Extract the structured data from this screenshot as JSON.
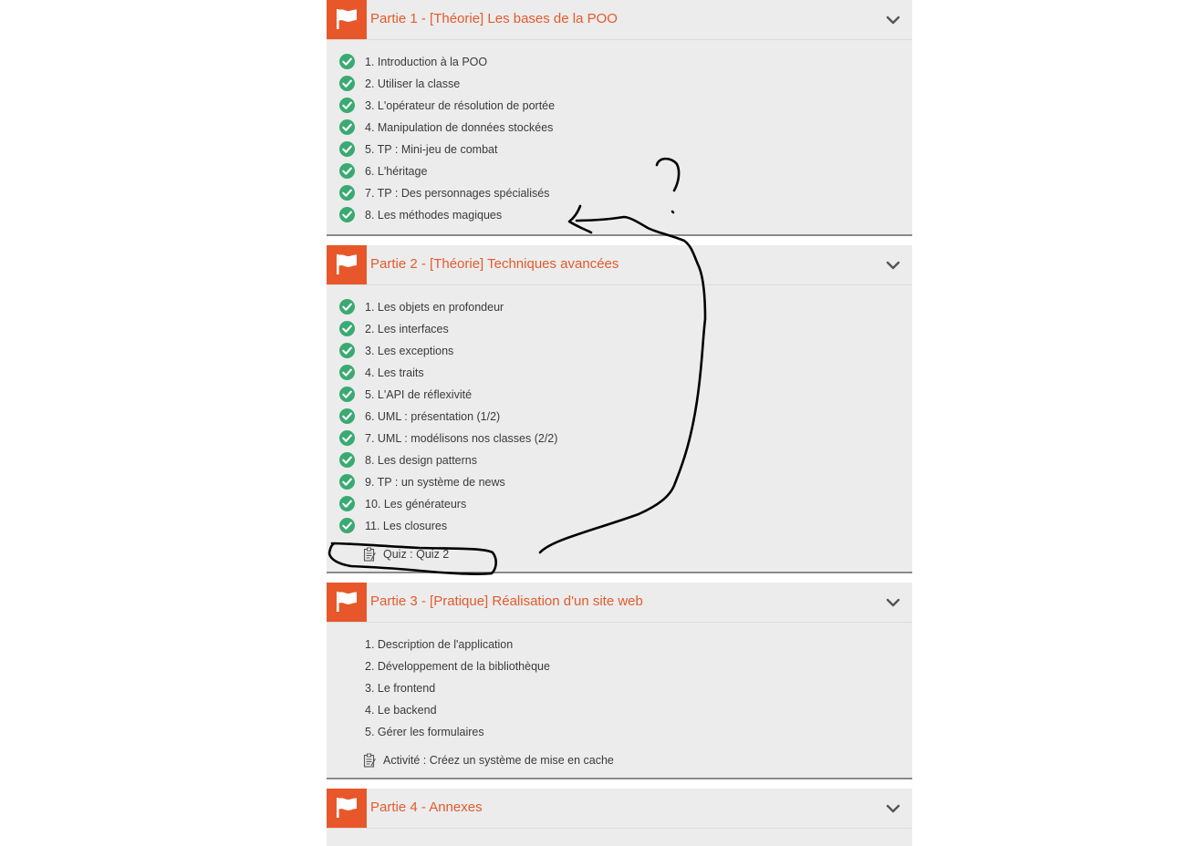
{
  "icons": {
    "section": "flag-icon",
    "done": "check-circle-icon",
    "quiz": "clipboard-icon",
    "toggle": "chevron-down-icon"
  },
  "colors": {
    "accent": "#e8572a",
    "title": "#e35a2c",
    "check": "#3aaa72",
    "panel": "#ececec",
    "annotation": "#000000"
  },
  "sections": [
    {
      "title": "Partie 1 - [Théorie] Les bases de la POO",
      "items": [
        {
          "label": "1. Introduction à la POO",
          "completed": true
        },
        {
          "label": "2. Utiliser la classe",
          "completed": true
        },
        {
          "label": "3. L'opérateur de résolution de portée",
          "completed": true
        },
        {
          "label": "4. Manipulation de données stockées",
          "completed": true
        },
        {
          "label": "5. TP : Mini-jeu de combat",
          "completed": true
        },
        {
          "label": "6. L'héritage",
          "completed": true
        },
        {
          "label": "7. TP : Des personnages spécialisés",
          "completed": true
        },
        {
          "label": "8. Les méthodes magiques",
          "completed": true
        }
      ]
    },
    {
      "title": "Partie 2 - [Théorie] Techniques avancées",
      "items": [
        {
          "label": "1. Les objets en profondeur",
          "completed": true
        },
        {
          "label": "2. Les interfaces",
          "completed": true
        },
        {
          "label": "3. Les exceptions",
          "completed": true
        },
        {
          "label": "4. Les traits",
          "completed": true
        },
        {
          "label": "5. L'API de réflexivité",
          "completed": true
        },
        {
          "label": "6. UML : présentation (1/2)",
          "completed": true
        },
        {
          "label": "7. UML : modélisons nos classes (2/2)",
          "completed": true
        },
        {
          "label": "8. Les design patterns",
          "completed": true
        },
        {
          "label": "9. TP : un système de news",
          "completed": true
        },
        {
          "label": "10. Les générateurs",
          "completed": true
        },
        {
          "label": "11. Les closures",
          "completed": true
        }
      ],
      "extra": {
        "label": "Quiz : Quiz 2"
      }
    },
    {
      "title": "Partie 3 - [Pratique] Réalisation d'un site web",
      "items": [
        {
          "label": "1. Description de l'application",
          "completed": false
        },
        {
          "label": "2. Développement de la bibliothèque",
          "completed": false
        },
        {
          "label": "3. Le frontend",
          "completed": false
        },
        {
          "label": "4. Le backend",
          "completed": false
        },
        {
          "label": "5. Gérer les formulaires",
          "completed": false
        }
      ],
      "extra": {
        "label": "Activité : Créez un système de mise en cache"
      }
    },
    {
      "title": "Partie 4 - Annexes",
      "items": []
    }
  ]
}
